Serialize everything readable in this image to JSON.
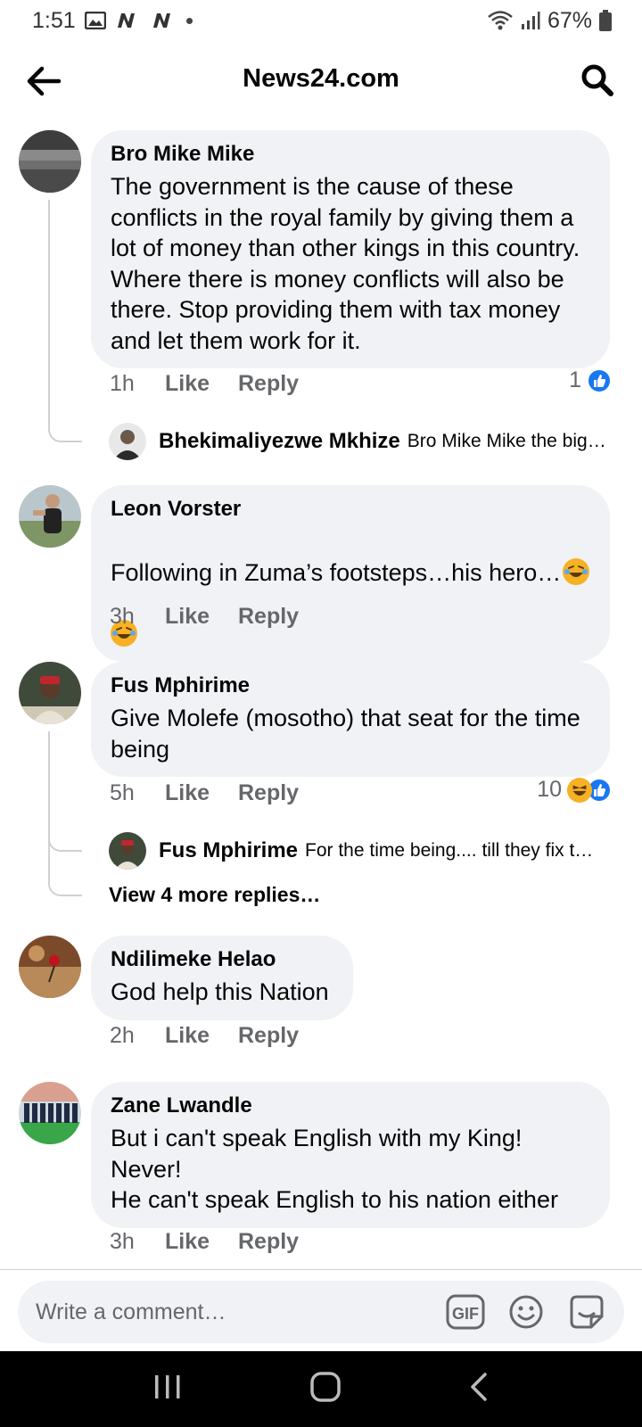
{
  "status_bar": {
    "time": "1:51",
    "battery": "67%"
  },
  "header": {
    "title": "News24.com"
  },
  "comments": [
    {
      "author": "Bro Mike Mike",
      "text": "The government is the cause of these\nconflicts in the royal family by giving them a\nlot of money than other kings in this country.\nWhere there is money conflicts will also be\nthere. Stop providing them with tax money\nand let them work for it.",
      "time": "1h",
      "like": "Like",
      "reply": "Reply",
      "reaction_count": "1",
      "reply_preview": {
        "author": "Bhekimaliyezwe Mkhize",
        "snippet": "Bro Mike Mike the big…"
      }
    },
    {
      "author": "Leon Vorster",
      "text": "Following in Zuma’s footsteps…his hero…",
      "time": "3h",
      "like": "Like",
      "reply": "Reply"
    },
    {
      "author": "Fus Mphirime",
      "text": "Give Molefe (mosotho) that seat for the time\nbeing",
      "time": "5h",
      "like": "Like",
      "reply": "Reply",
      "reaction_count": "10",
      "reply_preview": {
        "author": "Fus Mphirime",
        "snippet": "For the time being.... till they fix t…"
      },
      "more_replies": "View 4 more replies…"
    },
    {
      "author": "Ndilimeke Helao",
      "text": "God help this Nation",
      "time": "2h",
      "like": "Like",
      "reply": "Reply"
    },
    {
      "author": "Zane Lwandle",
      "text": "But i can't speak English with my King!\nNever!\nHe can't speak English to his nation either",
      "time": "3h",
      "like": "Like",
      "reply": "Reply"
    }
  ],
  "composer": {
    "placeholder": "Write a comment…",
    "gif_label": "GIF"
  },
  "colors": {
    "bubble": "#f0f2f5",
    "secondary_text": "#65676b",
    "like_blue": "#1877f2",
    "haha_yellow": "#f7b125"
  }
}
